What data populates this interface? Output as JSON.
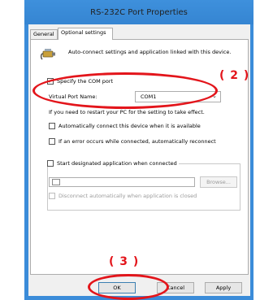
{
  "window": {
    "title": "RS-232C Port Properties"
  },
  "tabs": [
    {
      "label": "General"
    },
    {
      "label": "Optional settings"
    }
  ],
  "intro_text": "Auto-connect settings and application linked with this device.",
  "specify_com_port": {
    "label": "Specify the COM port",
    "checked": true
  },
  "virtual_port": {
    "label": "Virtual Port Name:",
    "value": "COM1"
  },
  "note": "If you need to restart your PC for the setting to take effect.",
  "auto_connect": {
    "label": "Automatically connect this device when it is available",
    "checked": false
  },
  "auto_reconnect": {
    "label": "If an error occurs while connected, automatically reconnect",
    "checked": false
  },
  "designated_app": {
    "label": "Start designated application when connected",
    "checked": false
  },
  "browse_label": "Browse...",
  "disconnect_auto": {
    "label": "Disconnect automatically when application is closed",
    "checked": false
  },
  "buttons": {
    "ok": "OK",
    "cancel": "Cancel",
    "apply": "Apply"
  },
  "annotations": {
    "label_2": "( 2 )",
    "label_3": "( 3 )",
    "color": "#e3151b"
  }
}
